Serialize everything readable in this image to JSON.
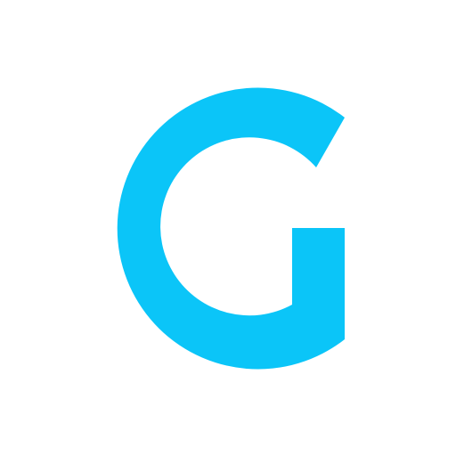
{
  "logo": {
    "icon": "letter-g-logo-icon",
    "letter": "G",
    "color": "#0BC5F8"
  },
  "background": "#FFFFFF"
}
